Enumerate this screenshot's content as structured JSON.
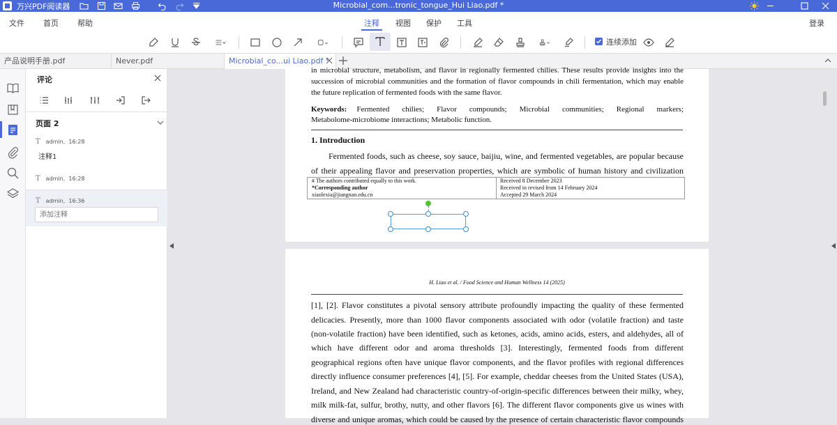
{
  "titlebar": {
    "app_name": "万兴PDF阅读器",
    "window_title": "Microbial_com...tronic_tongue_Hui Liao.pdf *"
  },
  "menu": {
    "file": "文件",
    "home": "首页",
    "help": "帮助",
    "tabs": [
      "注释",
      "视图",
      "保护",
      "工具"
    ],
    "login": "登录"
  },
  "toolbar": {
    "continuous_add": "连续添加"
  },
  "doc_tabs": [
    {
      "label": "产品说明手册.pdf"
    },
    {
      "label": "Never.pdf"
    },
    {
      "label": "Microbial_co...ui Liao.pdf *"
    }
  ],
  "panel": {
    "title": "评论",
    "page_header": "页面 2",
    "comments": [
      {
        "author": "admin,",
        "time": "16:28",
        "text": "注释1"
      },
      {
        "author": "admin,",
        "time": "16:28",
        "text": ""
      },
      {
        "author": "admin,",
        "time": "16:36",
        "text": ""
      }
    ],
    "add_note_placeholder": "添加注释"
  },
  "page1": {
    "lines": [
      "in microbial structure, metabolism, and flavor in regionally fermented chilies. These results provide insights into the",
      "succession of microbial communities and the formation of flavor compounds in chili fermentation, which may enable",
      "the future replication of fermented foods with the same flavor."
    ],
    "keywords_label": "Keywords:",
    "keywords_line1": "Fermented chilies; Flavor compounds; Microbial communities; Regional markers;",
    "keywords_line2": "Metabolome-microbiome interactions; Metabolic function.",
    "intro_heading": "1. Introduction",
    "intro_line1": "Fermented foods, such as cheese, soy sauce, baijiu, wine, and fermented vegetables, are popular because",
    "intro_line2": "of their appealing flavor and preservation properties, which are symbolic of human history and civilization",
    "footnote_left": [
      "# The authors contributed equally to this work.",
      "*Corresponding author",
      "xiaolexia@jiangnan.edu.cn"
    ],
    "footnote_right": [
      "Received 8 December 2023",
      "Received in revised from 14 February 2024",
      "Accepted 29 March 2024"
    ]
  },
  "page2": {
    "running_head": "H. Liao et al. / Food Science and Human Wellness 14 (2025)",
    "lines": [
      "[1], [2]. Flavor constitutes a pivotal sensory attribute profoundly impacting the quality of these fermented",
      "delicacies. Presently, more than 1000 flavor components associated with odor (volatile fraction) and taste",
      "(non-volatile fraction) have been identified, such as ketones, acids, amino acids, esters, and aldehydes, all of",
      "which have different odor and aroma thresholds [3]. Interestingly, fermented foods from different",
      "geographical regions often have unique flavor components, and the flavor profiles with regional differences",
      "directly influence consumer preferences [4], [5]. For example, cheddar cheeses from the United States (USA),",
      "Ireland, and New Zealand had characteristic country-of-origin-specific differences between their milky, whey,",
      "milk milk-fat, sulfur, brothy, nutty, and other flavors [6]. The different flavor components give us wines with",
      "diverse and unique aromas, which could be caused by the presence of certain characteristic flavor compounds"
    ]
  }
}
